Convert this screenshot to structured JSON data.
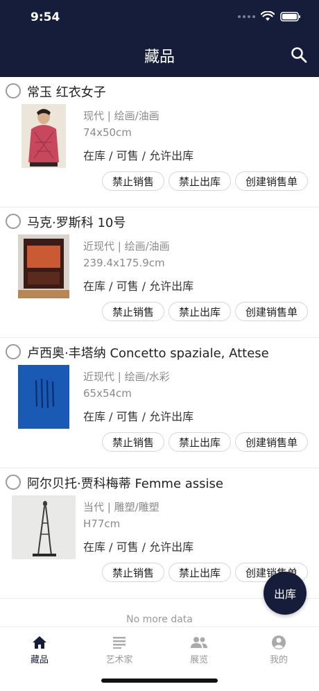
{
  "status_bar": {
    "time": "9:54"
  },
  "header": {
    "title": "藏品",
    "search_icon": "search-icon",
    "bg_color": "#161d3a"
  },
  "items": [
    {
      "title": "常玉 红衣女子",
      "category": "现代 | 绘画/油画",
      "size": "74x50cm",
      "status": "在库 / 可售 / 允许出库",
      "buttons": [
        "禁止销售",
        "禁止出库",
        "创建销售单"
      ]
    },
    {
      "title": "马克·罗斯科 10号",
      "category": "近现代 | 绘画/油画",
      "size": "239.4x175.9cm",
      "status": "在库 / 可售 / 允许出库",
      "buttons": [
        "禁止销售",
        "禁止出库",
        "创建销售单"
      ]
    },
    {
      "title": "卢西奥·丰塔纳 Concetto spaziale, Attese",
      "category": "近现代 | 绘画/水彩",
      "size": "65x54cm",
      "status": "在库 / 可售 / 允许出库",
      "buttons": [
        "禁止销售",
        "禁止出库",
        "创建销售单"
      ]
    },
    {
      "title": "阿尔贝托·贾科梅蒂 Femme assise",
      "category": "当代 | 雕塑/雕塑",
      "size": "H77cm",
      "status": "在库 / 可售 / 允许出库",
      "buttons": [
        "禁止销售",
        "禁止出库",
        "创建销售单"
      ]
    }
  ],
  "no_more": "No more data",
  "fab": {
    "label": "出库"
  },
  "tabs": [
    {
      "label": "藏品",
      "icon": "home-icon",
      "active": true
    },
    {
      "label": "艺术家",
      "icon": "list-icon",
      "active": false
    },
    {
      "label": "展览",
      "icon": "people-icon",
      "active": false
    },
    {
      "label": "我的",
      "icon": "profile-icon",
      "active": false
    }
  ]
}
